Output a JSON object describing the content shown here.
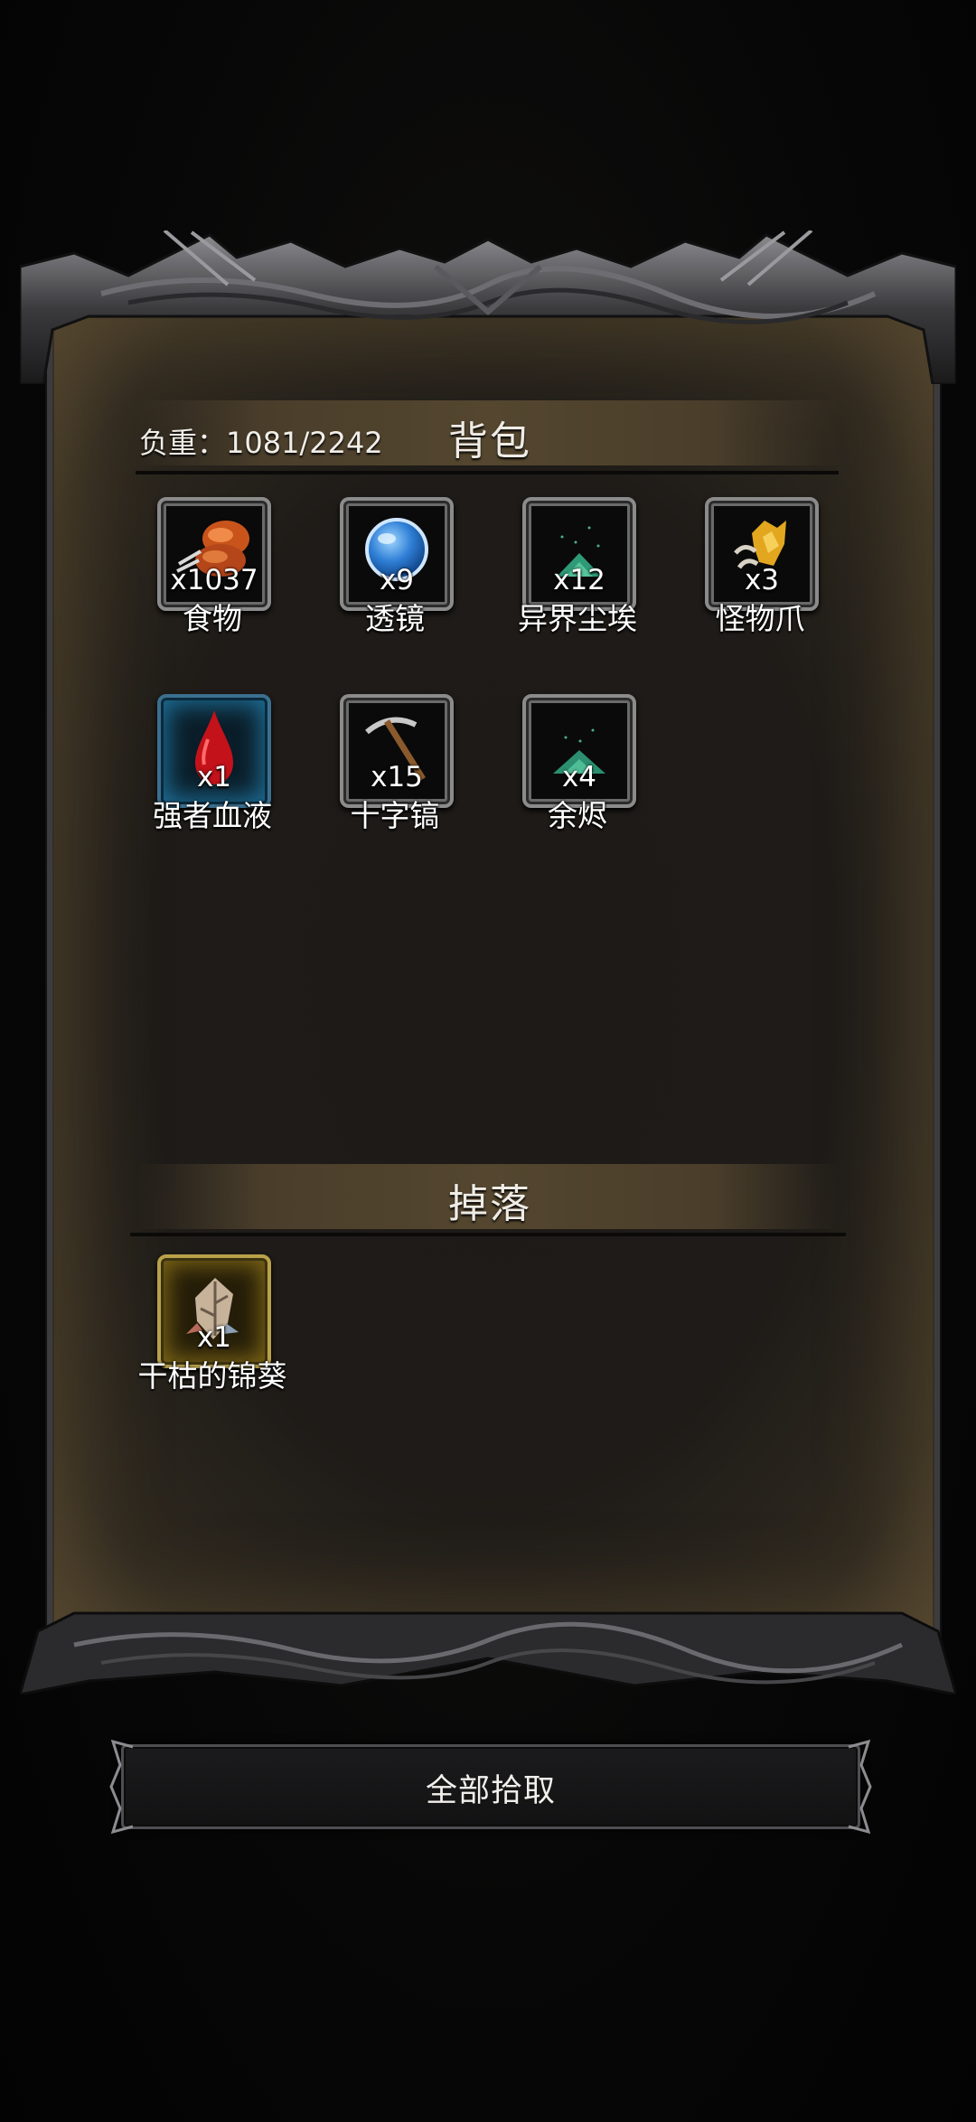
{
  "backpack": {
    "title": "背包",
    "weight_label": "负重：1081/2242",
    "items": [
      {
        "name": "食物",
        "count": "x1037",
        "icon": "food-icon"
      },
      {
        "name": "透镜",
        "count": "x9",
        "icon": "lens-icon"
      },
      {
        "name": "异界尘埃",
        "count": "x12",
        "icon": "otherworld-dust-icon"
      },
      {
        "name": "怪物爪",
        "count": "x3",
        "icon": "monster-claw-icon"
      },
      {
        "name": "强者血液",
        "count": "x1",
        "icon": "blood-drop-icon"
      },
      {
        "name": "十字镐",
        "count": "x15",
        "icon": "pickaxe-icon"
      },
      {
        "name": "余烬",
        "count": "x4",
        "icon": "ember-dust-icon"
      }
    ]
  },
  "drops": {
    "title": "掉落",
    "items": [
      {
        "name": "干枯的锦葵",
        "count": "x1",
        "icon": "dried-mallow-icon"
      }
    ]
  },
  "collect_all_label": "全部拾取",
  "colors": {
    "panel": "#1e1b18",
    "header_band": "#54462f",
    "frame": "#3c3c3e",
    "rare_blue": "#1e6d95",
    "rare_gold": "#b9a14a"
  }
}
